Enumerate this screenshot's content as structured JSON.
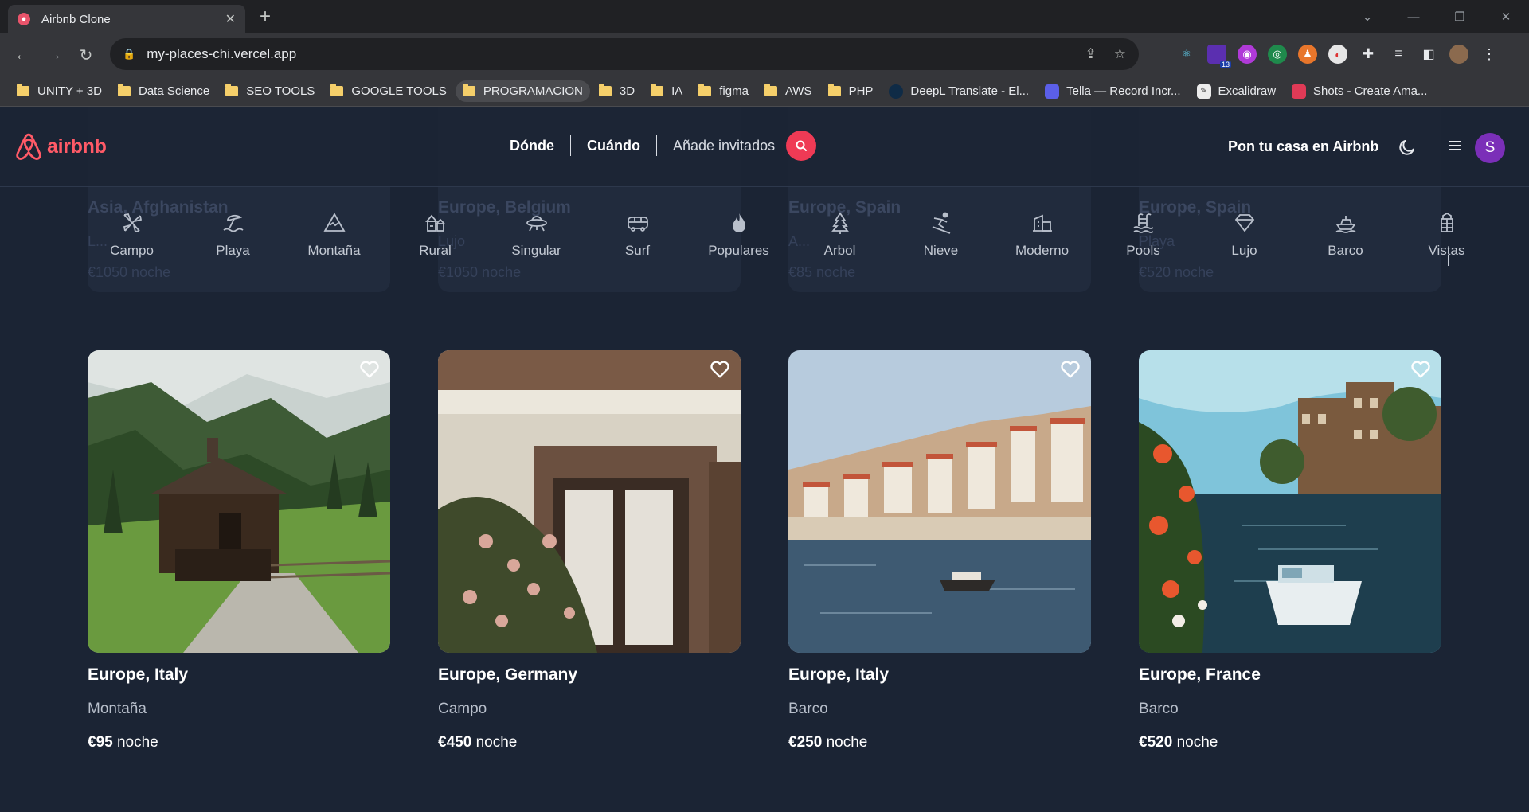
{
  "browser": {
    "tab_title": "Airbnb Clone",
    "url": "my-places-chi.vercel.app",
    "extensions_badge": "13",
    "bookmarks": [
      {
        "label": "UNITY + 3D",
        "type": "folder"
      },
      {
        "label": "Data Science",
        "type": "folder"
      },
      {
        "label": "SEO TOOLS",
        "type": "folder"
      },
      {
        "label": "GOOGLE TOOLS",
        "type": "folder"
      },
      {
        "label": "PROGRAMACION",
        "type": "folder"
      },
      {
        "label": "3D",
        "type": "folder"
      },
      {
        "label": "IA",
        "type": "folder"
      },
      {
        "label": "figma",
        "type": "folder"
      },
      {
        "label": "AWS",
        "type": "folder"
      },
      {
        "label": "PHP",
        "type": "folder"
      },
      {
        "label": "DeepL Translate - El...",
        "type": "site"
      },
      {
        "label": "Tella — Record Incr...",
        "type": "site"
      },
      {
        "label": "Excalidraw",
        "type": "site"
      },
      {
        "label": "Shots - Create Ama...",
        "type": "site"
      }
    ]
  },
  "header": {
    "logo_text": "airbnb",
    "search": {
      "where": "Dónde",
      "when": "Cuándo",
      "guests": "Añade invitados"
    },
    "host_link": "Pon tu casa en Airbnb",
    "avatar_initial": "S"
  },
  "ghost_cards": [
    {
      "title": "Asia, Afghanistan",
      "sub": "L...",
      "price": "€1050 noche"
    },
    {
      "title": "Europe, Belgium",
      "sub": "Lujo",
      "price": "€1050 noche"
    },
    {
      "title": "Europe, Spain",
      "sub": "A...",
      "price": "€85 noche"
    },
    {
      "title": "Europe, Spain",
      "sub": "Playa",
      "price": "€520 noche"
    }
  ],
  "categories": [
    {
      "label": "Campo",
      "icon": "windmill-icon"
    },
    {
      "label": "Playa",
      "icon": "beach-icon"
    },
    {
      "label": "Montaña",
      "icon": "mountain-icon"
    },
    {
      "label": "Rural",
      "icon": "barn-icon"
    },
    {
      "label": "Singular",
      "icon": "ufo-icon"
    },
    {
      "label": "Surf",
      "icon": "van-icon"
    },
    {
      "label": "Populares",
      "icon": "flame-icon"
    },
    {
      "label": "Arbol",
      "icon": "tree-icon"
    },
    {
      "label": "Nieve",
      "icon": "skier-icon"
    },
    {
      "label": "Moderno",
      "icon": "building-icon"
    },
    {
      "label": "Pools",
      "icon": "pool-icon"
    },
    {
      "label": "Lujo",
      "icon": "diamond-icon"
    },
    {
      "label": "Barco",
      "icon": "boat-icon"
    },
    {
      "label": "Vistas",
      "icon": "tower-icon"
    }
  ],
  "listings": [
    {
      "location": "Europe, Italy",
      "category": "Montaña",
      "price": "€95",
      "unit": "noche"
    },
    {
      "location": "Europe, Germany",
      "category": "Campo",
      "price": "€450",
      "unit": "noche"
    },
    {
      "location": "Europe, Italy",
      "category": "Barco",
      "price": "€250",
      "unit": "noche"
    },
    {
      "location": "Europe, France",
      "category": "Barco",
      "price": "€520",
      "unit": "noche"
    }
  ],
  "colors": {
    "brand": "#ff5a67",
    "search_button": "#ef3a55",
    "page_bg": "#1b2434",
    "avatar": "#7b2fb8"
  }
}
